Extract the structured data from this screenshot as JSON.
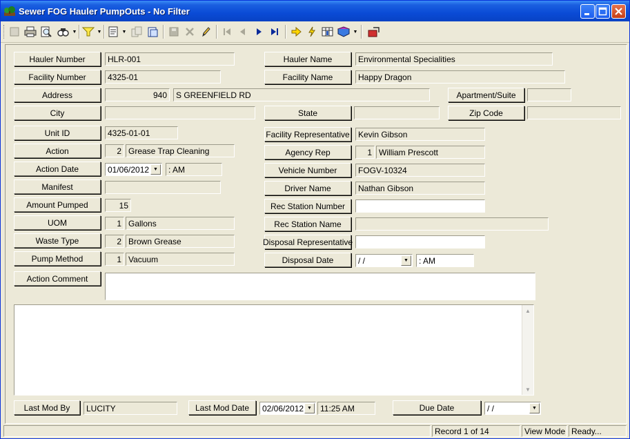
{
  "window": {
    "title": "Sewer FOG Hauler PumpOuts - No Filter"
  },
  "icons": {
    "app": "tree-icon",
    "minimize": "minimize-icon",
    "maximize": "maximize-icon",
    "close": "close-icon",
    "toolbar": [
      "new-record-icon",
      "print-icon",
      "print-preview-icon",
      "find-icon",
      "filter-icon",
      "view-icon",
      "copy-icon",
      "clipboard-icon",
      "save-icon",
      "delete-icon",
      "edit-icon",
      "first-record-icon",
      "previous-record-icon",
      "next-record-icon",
      "last-record-icon",
      "go-to-icon",
      "lightning-icon",
      "report-icon",
      "book-icon",
      "exit-icon"
    ]
  },
  "form": {
    "hauler_number": {
      "label": "Hauler Number",
      "value": "HLR-001"
    },
    "hauler_name": {
      "label": "Hauler Name",
      "value": "Environmental Specialities"
    },
    "facility_number": {
      "label": "Facility Number",
      "value": "4325-01"
    },
    "facility_name": {
      "label": "Facility Name",
      "value": "Happy Dragon"
    },
    "address": {
      "label": "Address",
      "number": "940",
      "street": "S GREENFIELD RD"
    },
    "apartment": {
      "label": "Apartment/Suite",
      "value": ""
    },
    "city": {
      "label": "City",
      "value": ""
    },
    "state": {
      "label": "State",
      "value": ""
    },
    "zip": {
      "label": "Zip Code",
      "value": ""
    },
    "unit_id": {
      "label": "Unit ID",
      "value": "4325-01-01"
    },
    "facility_rep": {
      "label": "Facility Representative",
      "value": "Kevin Gibson"
    },
    "action": {
      "label": "Action",
      "code": "2",
      "value": "Grease Trap Cleaning"
    },
    "agency_rep": {
      "label": "Agency Rep",
      "code": "1",
      "value": "William Prescott"
    },
    "action_date": {
      "label": "Action Date",
      "date": "01/06/2012",
      "time": "  :  AM"
    },
    "vehicle_number": {
      "label": "Vehicle Number",
      "value": "FOGV-10324"
    },
    "manifest": {
      "label": "Manifest",
      "value": ""
    },
    "driver_name": {
      "label": "Driver Name",
      "value": "Nathan Gibson"
    },
    "amount_pumped": {
      "label": "Amount Pumped",
      "value": "15"
    },
    "rec_station_number": {
      "label": "Rec Station Number",
      "value": ""
    },
    "uom": {
      "label": "UOM",
      "code": "1",
      "value": "Gallons"
    },
    "rec_station_name": {
      "label": "Rec Station Name",
      "value": ""
    },
    "waste_type": {
      "label": "Waste Type",
      "code": "2",
      "value": "Brown Grease"
    },
    "disposal_rep": {
      "label": "Disposal Representative",
      "value": ""
    },
    "pump_method": {
      "label": "Pump Method",
      "code": "1",
      "value": "Vacuum"
    },
    "disposal_date": {
      "label": "Disposal Date",
      "date": " / /",
      "time": "  :  AM"
    },
    "action_comment": {
      "label": "Action Comment",
      "value": ""
    },
    "last_mod_by": {
      "label": "Last Mod By",
      "value": "LUCITY"
    },
    "last_mod_date": {
      "label": "Last Mod Date",
      "date": "02/06/2012",
      "time": "11:25 AM"
    },
    "due_date": {
      "label": "Due Date",
      "date": " / /"
    }
  },
  "status": {
    "record": "Record 1 of 14",
    "mode": "View Mode",
    "state": "Ready..."
  }
}
